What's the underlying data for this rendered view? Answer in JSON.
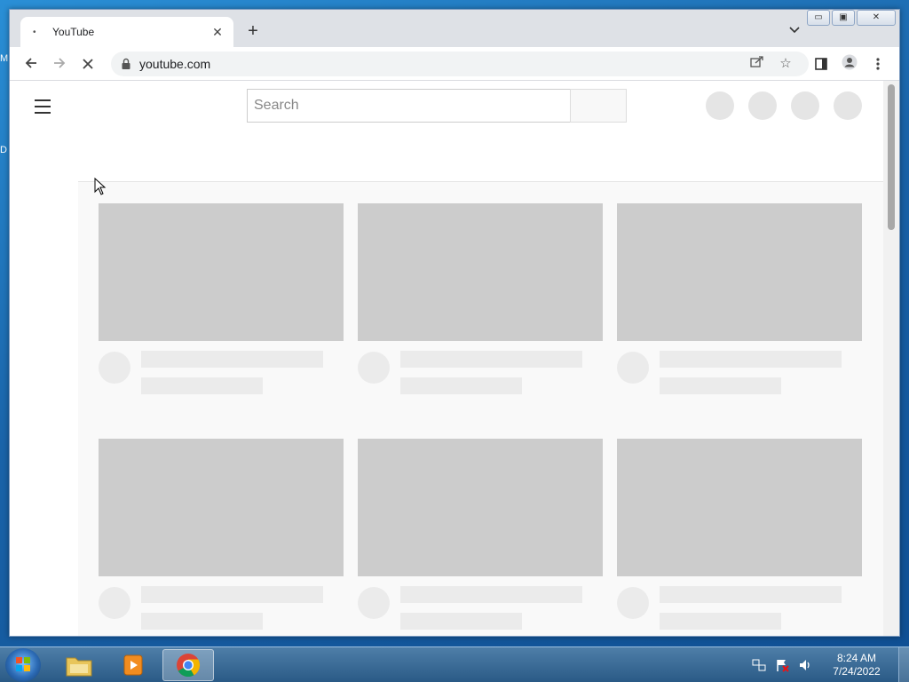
{
  "desktop": {
    "frag1": "M",
    "frag2": "D"
  },
  "browser": {
    "tab": {
      "title": "YouTube",
      "close": "✕"
    },
    "newtab": "+",
    "omnibox": {
      "url": "youtube.com"
    },
    "window_controls": {
      "minimize": "▭",
      "maximize": "▣",
      "close": "✕"
    }
  },
  "youtube": {
    "search": {
      "placeholder": "Search"
    }
  },
  "taskbar": {
    "clock": {
      "time": "8:24 AM",
      "date": "7/24/2022"
    }
  },
  "colors": {
    "skeleton": "#cccccc",
    "skeleton_light": "#ebebeb",
    "desktop": "#1d6fb0"
  }
}
